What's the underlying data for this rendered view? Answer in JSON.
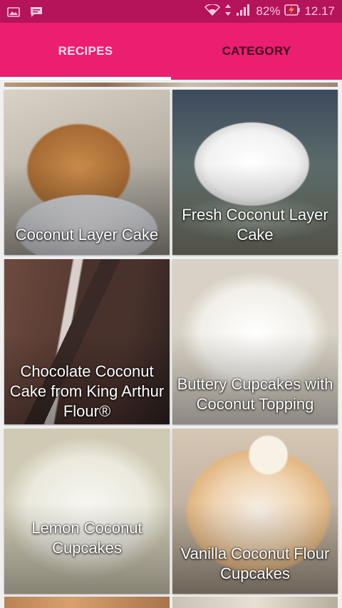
{
  "status_bar": {
    "battery_percent": "82%",
    "time": "12.17",
    "icons": [
      "image-icon",
      "message-icon",
      "wifi-icon",
      "data-arrows-icon",
      "signal-icon",
      "battery-charging-icon"
    ]
  },
  "tabs": [
    {
      "label": "RECIPES",
      "active": true
    },
    {
      "label": "CATEGORY",
      "active": false
    }
  ],
  "recipes": [
    {
      "title": "Coconut Layer Cake"
    },
    {
      "title": "Fresh Coconut Layer Cake"
    },
    {
      "title": "Chocolate Coconut Cake from King Arthur Flour®"
    },
    {
      "title": "Buttery Cupcakes with Coconut Topping"
    },
    {
      "title": "Lemon Coconut Cupcakes"
    },
    {
      "title": "Vanilla Coconut Flour Cupcakes"
    }
  ],
  "colors": {
    "status_bar": "#b5135a",
    "app_bar": "#ec1e70",
    "tab_active_text": "#ffe1ee",
    "tab_inactive_text": "#3b0a1c",
    "indicator": "#ffffff"
  }
}
